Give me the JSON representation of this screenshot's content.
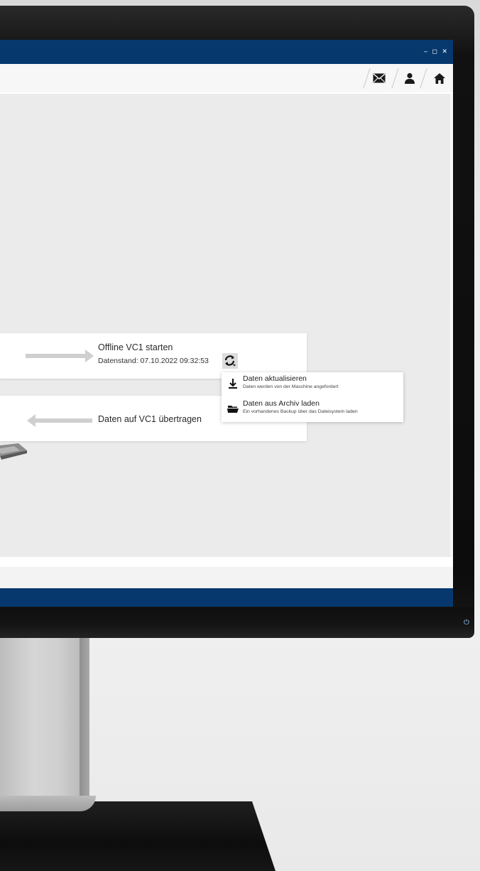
{
  "window": {
    "controls": "‒ ◻ ✕"
  },
  "toolbar": {
    "icons": [
      "mail-icon",
      "user-icon",
      "home-icon"
    ]
  },
  "panels": {
    "offline": {
      "title": "Offline VC1 starten",
      "status": "Datenstand: 07.10.2022 09:32:53"
    },
    "transfer": {
      "title": "Daten auf VC1 übertragen"
    }
  },
  "dropdown": {
    "items": [
      {
        "title": "Daten aktualisieren",
        "subtitle": "Daten werden von der Maschine angefordert",
        "icon": "download-icon"
      },
      {
        "title": "Daten aus Archiv laden",
        "subtitle": "Ein vorhandenes Backup über das Dateisystem laden",
        "icon": "folder-open-icon"
      }
    ]
  },
  "colors": {
    "accent": "#06386e",
    "background": "#ebebeb",
    "panel": "#ffffff"
  }
}
